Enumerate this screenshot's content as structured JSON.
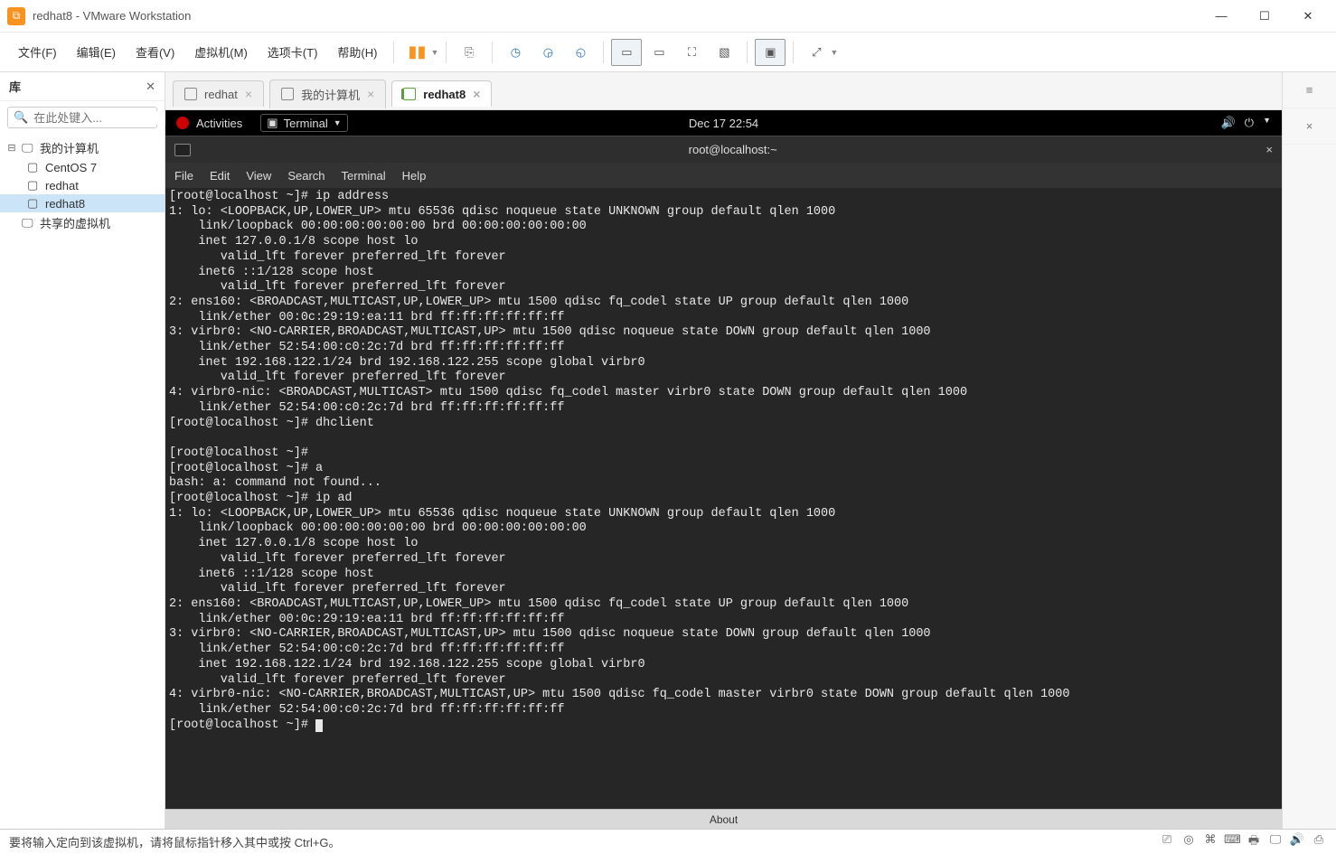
{
  "window": {
    "title": "redhat8 - VMware Workstation"
  },
  "menu": {
    "items": [
      "文件(F)",
      "编辑(E)",
      "查看(V)",
      "虚拟机(M)",
      "选项卡(T)",
      "帮助(H)"
    ]
  },
  "sidebar": {
    "title": "库",
    "search_placeholder": "在此处键入...",
    "root": "我的计算机",
    "items": [
      "CentOS 7",
      "redhat",
      "redhat8"
    ],
    "shared": "共享的虚拟机"
  },
  "tabs": [
    {
      "label": "redhat",
      "active": false
    },
    {
      "label": "我的计算机",
      "active": false
    },
    {
      "label": "redhat8",
      "active": true
    }
  ],
  "gnome": {
    "activities": "Activities",
    "app": "Terminal",
    "clock": "Dec 17  22:54"
  },
  "terminal": {
    "title": "root@localhost:~",
    "menu": [
      "File",
      "Edit",
      "View",
      "Search",
      "Terminal",
      "Help"
    ],
    "output": "[root@localhost ~]# ip address\n1: lo: <LOOPBACK,UP,LOWER_UP> mtu 65536 qdisc noqueue state UNKNOWN group default qlen 1000\n    link/loopback 00:00:00:00:00:00 brd 00:00:00:00:00:00\n    inet 127.0.0.1/8 scope host lo\n       valid_lft forever preferred_lft forever\n    inet6 ::1/128 scope host\n       valid_lft forever preferred_lft forever\n2: ens160: <BROADCAST,MULTICAST,UP,LOWER_UP> mtu 1500 qdisc fq_codel state UP group default qlen 1000\n    link/ether 00:0c:29:19:ea:11 brd ff:ff:ff:ff:ff:ff\n3: virbr0: <NO-CARRIER,BROADCAST,MULTICAST,UP> mtu 1500 qdisc noqueue state DOWN group default qlen 1000\n    link/ether 52:54:00:c0:2c:7d brd ff:ff:ff:ff:ff:ff\n    inet 192.168.122.1/24 brd 192.168.122.255 scope global virbr0\n       valid_lft forever preferred_lft forever\n4: virbr0-nic: <BROADCAST,MULTICAST> mtu 1500 qdisc fq_codel master virbr0 state DOWN group default qlen 1000\n    link/ether 52:54:00:c0:2c:7d brd ff:ff:ff:ff:ff:ff\n[root@localhost ~]# dhclient\n\n[root@localhost ~]#\n[root@localhost ~]# a\nbash: a: command not found...\n[root@localhost ~]# ip ad\n1: lo: <LOOPBACK,UP,LOWER_UP> mtu 65536 qdisc noqueue state UNKNOWN group default qlen 1000\n    link/loopback 00:00:00:00:00:00 brd 00:00:00:00:00:00\n    inet 127.0.0.1/8 scope host lo\n       valid_lft forever preferred_lft forever\n    inet6 ::1/128 scope host\n       valid_lft forever preferred_lft forever\n2: ens160: <BROADCAST,MULTICAST,UP,LOWER_UP> mtu 1500 qdisc fq_codel state UP group default qlen 1000\n    link/ether 00:0c:29:19:ea:11 brd ff:ff:ff:ff:ff:ff\n3: virbr0: <NO-CARRIER,BROADCAST,MULTICAST,UP> mtu 1500 qdisc noqueue state DOWN group default qlen 1000\n    link/ether 52:54:00:c0:2c:7d brd ff:ff:ff:ff:ff:ff\n    inet 192.168.122.1/24 brd 192.168.122.255 scope global virbr0\n       valid_lft forever preferred_lft forever\n4: virbr0-nic: <NO-CARRIER,BROADCAST,MULTICAST,UP> mtu 1500 qdisc fq_codel master virbr0 state DOWN group default qlen 1000\n    link/ether 52:54:00:c0:2c:7d brd ff:ff:ff:ff:ff:ff\n[root@localhost ~]# "
  },
  "vmfoot": "About",
  "statusbar": {
    "hint": "要将输入定向到该虚拟机，请将鼠标指针移入其中或按 Ctrl+G。"
  }
}
